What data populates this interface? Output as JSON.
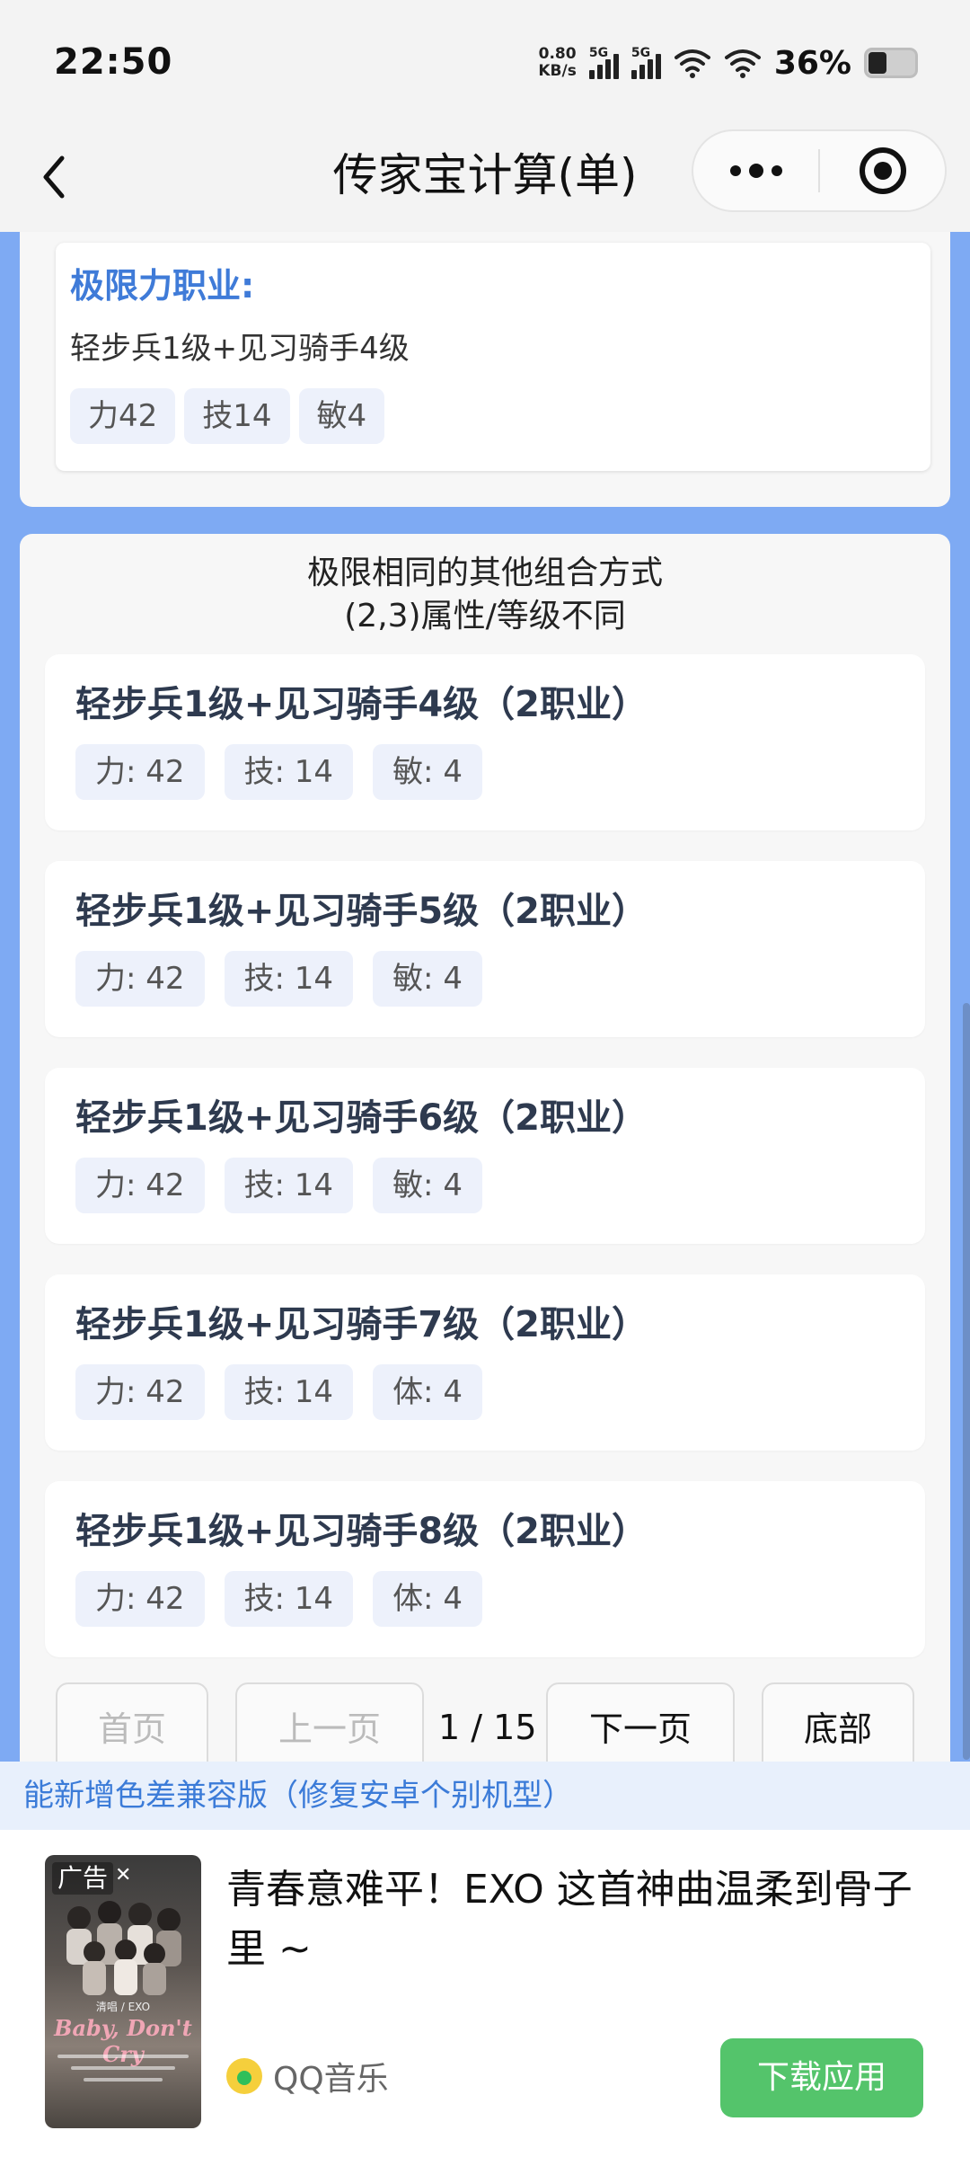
{
  "status_bar": {
    "time": "22:50",
    "net_speed_value": "0.80",
    "net_speed_unit": "KB/s",
    "signal1_label": "5G",
    "signal2_label": "5G",
    "battery": "36%",
    "battery_level_percent": 36
  },
  "nav": {
    "title": "传家宝计算(单)"
  },
  "limit_card": {
    "title": "极限力职业:",
    "description": "轻步兵1级+见习骑手4级",
    "stats": [
      "力42",
      "技14",
      "敏4"
    ]
  },
  "combos_panel": {
    "heading_line1": "极限相同的其他组合方式",
    "heading_line2": "(2,3)属性/等级不同",
    "items": [
      {
        "title": "轻步兵1级+见习骑手4级（2职业）",
        "stats": [
          "力: 42",
          "技: 14",
          "敏: 4"
        ]
      },
      {
        "title": "轻步兵1级+见习骑手5级（2职业）",
        "stats": [
          "力: 42",
          "技: 14",
          "敏: 4"
        ]
      },
      {
        "title": "轻步兵1级+见习骑手6级（2职业）",
        "stats": [
          "力: 42",
          "技: 14",
          "敏: 4"
        ]
      },
      {
        "title": "轻步兵1级+见习骑手7级（2职业）",
        "stats": [
          "力: 42",
          "技: 14",
          "体: 4"
        ]
      },
      {
        "title": "轻步兵1级+见习骑手8级（2职业）",
        "stats": [
          "力: 42",
          "技: 14",
          "体: 4"
        ]
      }
    ]
  },
  "pager": {
    "first": "首页",
    "prev": "上一页",
    "info": "1 / 15",
    "next": "下一页",
    "bottom": "底部"
  },
  "notice": "能新增色差兼容版（修复安卓个别机型）",
  "ad": {
    "badge": "广告",
    "headline": "青春意难平！EXO 这首神曲温柔到骨子里 ~",
    "source": "QQ音乐",
    "download": "下载应用",
    "poster_title": "Baby, Don't Cry",
    "poster_sub": "清唱 / EXO"
  },
  "colors": {
    "accent_blue": "#3f7bd8",
    "content_bg": "#7eaaf3",
    "download_green": "#54c46b"
  }
}
